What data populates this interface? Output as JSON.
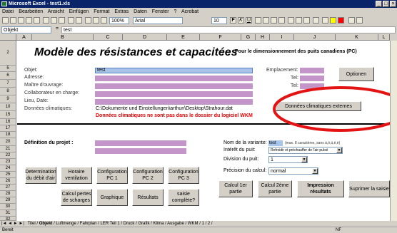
{
  "window": {
    "title": "Microsoft Excel - test1.xls"
  },
  "menu": [
    "Datei",
    "Bearbeiten",
    "Ansicht",
    "Einfügen",
    "Format",
    "Extras",
    "Daten",
    "Fenster",
    "?",
    "Acrobat"
  ],
  "toolbar": {
    "zoom": "100%",
    "font": "Arial",
    "size": "10"
  },
  "formula": {
    "namebox": "Objekt",
    "value": "test"
  },
  "columns": [
    "A",
    "B",
    "C",
    "D",
    "E",
    "F",
    "G",
    "H",
    "I",
    "J",
    "K",
    "L"
  ],
  "rows": [
    "2",
    "5",
    "6",
    "7",
    "8",
    "9",
    "10",
    "15",
    "16",
    "17",
    "18",
    "20",
    "21",
    "22",
    "23",
    "24",
    "25",
    "26",
    "27",
    "28",
    "29",
    "30",
    "31",
    "32",
    "33"
  ],
  "sheet": {
    "title": "Modèle des résistances et capacitées",
    "subtitle": "Pour le dimensionnement des puits canadiens (PC)",
    "labels": {
      "objet": "Objet:",
      "adresse": "Adresse:",
      "maitre": "Maître d'ouvrage:",
      "collab": "Collaborateur en charge:",
      "lieu": "Lieu, Date:",
      "donnees": "Données climatiques:",
      "emplacement": "Emplacement:",
      "tel1": "Tel:",
      "tel2": "Tel:"
    },
    "objet_value": "test",
    "climate_path": "C:\\Dokumente und Einstellungen\\arthun\\Desktop\\Strahour.dat",
    "climate_warning": "Données climatiques ne sont pas dans le dossier du logiciel WKM",
    "definition": "Définition du projet :",
    "variante_label": "Nom de la variante:",
    "variante_value": "test",
    "variante_hint": "(max. 8 caractères, sans à,ö,ü,é,è)",
    "interet_label": "Intérêt du puit:",
    "interet_value": "Refroidir et préchauffer de l'air pulsé",
    "division_label": "Division du puit:",
    "division_value": "1",
    "precision_label": "Précision du calcul:",
    "precision_value": "normal"
  },
  "buttons": {
    "options": "Optionen",
    "climate_external": "Données climatiques externes",
    "debit": "Determination du débit d'air",
    "horaire": "Horaire ventilation",
    "pc1": "Configuration PC 1",
    "pc2": "Configuration PC 2",
    "pc3": "Configuration PC 3",
    "calcul_pertes": "Calcul pertes de scharges",
    "graphique": "Graphique",
    "resultats": "Résultats",
    "saisie": "saisie complète?",
    "calcul1": "Calcul 1er partie",
    "calcul2": "Calcul 2ème partie",
    "impression": "Impression résultats",
    "supprimer": "Suprimer la saisie"
  },
  "tabs": [
    "Titel",
    "Objekt",
    "Luftmenge",
    "Fahrplan",
    "LER Teil 1",
    "Druck",
    "Grafik",
    "Klima",
    "Ausgabe",
    "WKM",
    "1",
    "2"
  ],
  "status": {
    "left": "Bereit",
    "right": "NF"
  },
  "colors": {
    "field": "#c495c8",
    "accent": "#0a246a",
    "warning": "#e00000",
    "circle": "#e41313"
  }
}
